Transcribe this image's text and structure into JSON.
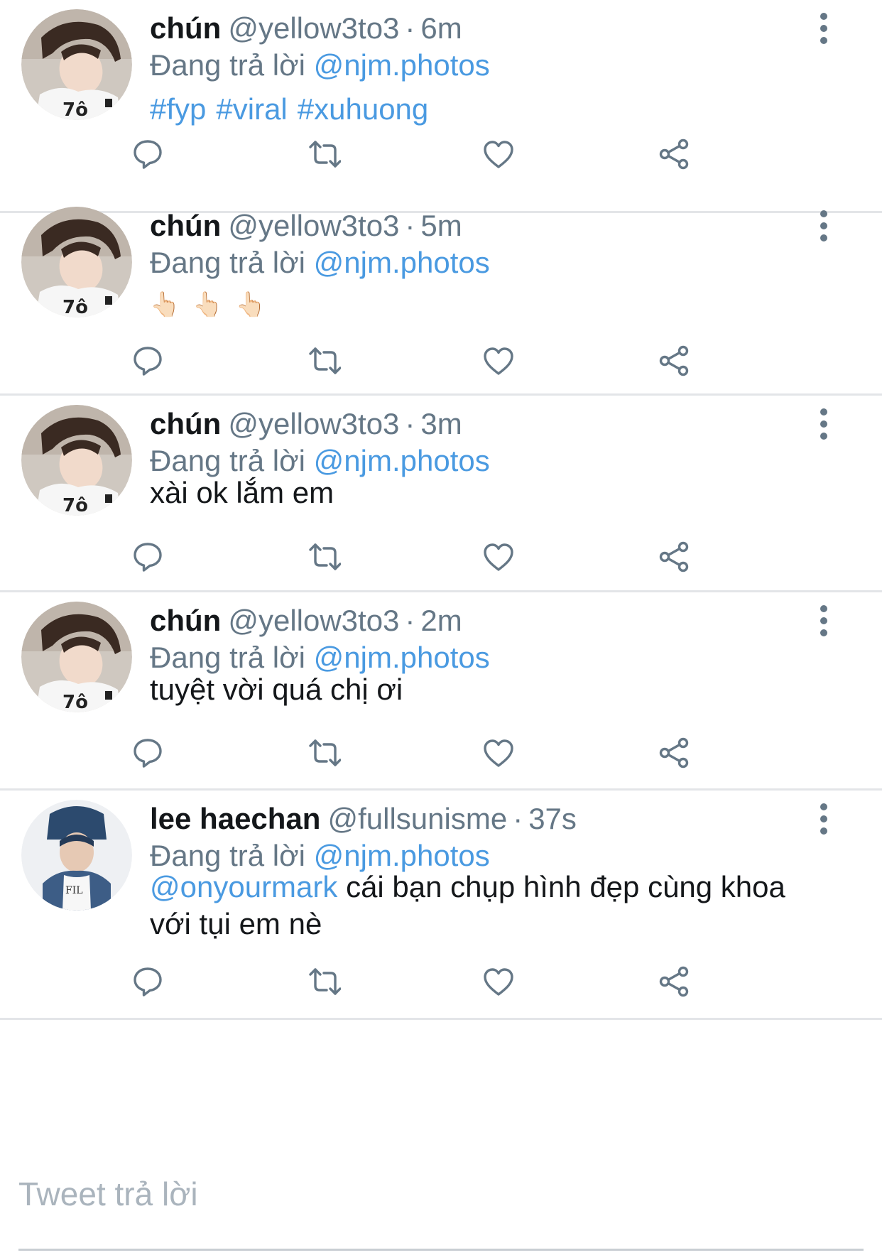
{
  "colors": {
    "accent": "#4a9ae1",
    "secondary": "#657786",
    "text": "#14171a",
    "divider": "#e3e5e8"
  },
  "reply_prefix": "Đang trả lời",
  "reply_to": "@njm.photos",
  "action_icons": [
    "reply-icon",
    "retweet-icon",
    "like-icon",
    "share-icon"
  ],
  "tweets": [
    {
      "name": "chún",
      "handle": "@yellow3to3",
      "time": "6m",
      "hashtags": [
        "#fyp",
        "#viral",
        "#xuhuong"
      ]
    },
    {
      "name": "chún",
      "handle": "@yellow3to3",
      "time": "5m",
      "emojis": [
        "👆🏻",
        "👆🏻",
        "👆🏻"
      ]
    },
    {
      "name": "chún",
      "handle": "@yellow3to3",
      "time": "3m",
      "text": "xài ok lắm em"
    },
    {
      "name": "chún",
      "handle": "@yellow3to3",
      "time": "2m",
      "text": "tuyệt vời quá chị ơi"
    },
    {
      "name": "lee haechan",
      "handle": "@fullsunisme",
      "time": "37s",
      "mention": "@onyourmark",
      "text_line1": "cái bạn chụp hình đẹp cùng khoa",
      "text_line2": "với tụi em nè"
    }
  ],
  "compose": {
    "placeholder": "Tweet trả lời"
  }
}
